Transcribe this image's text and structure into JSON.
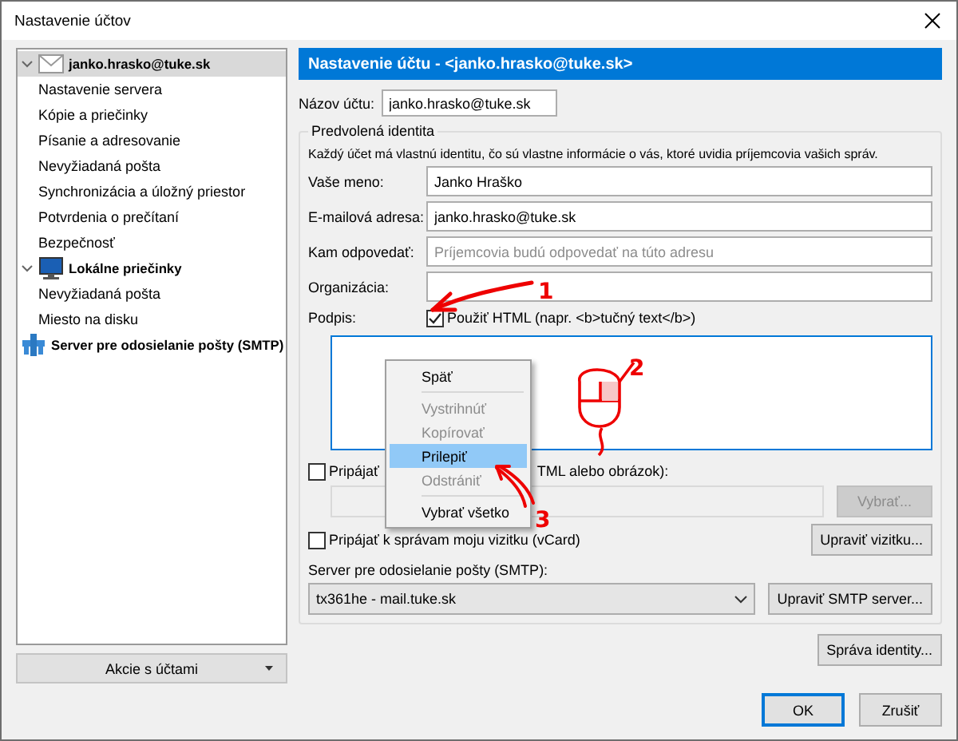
{
  "window": {
    "title": "Nastavenie účtov"
  },
  "sidebar": {
    "items": [
      {
        "label": "janko.hrasko@tuke.sk",
        "expanded": true,
        "selected": true,
        "children": [
          {
            "label": "Nastavenie servera",
            "selected": false
          },
          {
            "label": "Kópie a priečinky",
            "selected": false
          },
          {
            "label": "Písanie a adresovanie",
            "selected": false
          },
          {
            "label": "Nevyžiadaná pošta",
            "selected": false
          },
          {
            "label": "Synchronizácia a úložný priestor",
            "selected": false
          },
          {
            "label": "Potvrdenia o prečítaní",
            "selected": false
          },
          {
            "label": "Bezpečnosť",
            "selected": false
          }
        ]
      },
      {
        "label": "Lokálne priečinky",
        "expanded": true,
        "selected": false,
        "children": [
          {
            "label": "Nevyžiadaná pošta",
            "selected": false
          },
          {
            "label": "Miesto na disku",
            "selected": false
          }
        ]
      },
      {
        "label": "Server pre odosielanie pošty (SMTP)",
        "selected": false
      }
    ]
  },
  "account_actions": {
    "label": "Akcie s účtami"
  },
  "header": "Nastavenie účtu - <janko.hrasko@tuke.sk>",
  "account_name": {
    "label": "Názov účtu:",
    "value": "janko.hrasko@tuke.sk"
  },
  "identity": {
    "title": "Predvolená identita",
    "description": "Každý účet má vlastnú identitu, čo sú vlastne informácie o vás, ktoré uvidia príjemcovia vašich správ.",
    "fields": [
      {
        "label": "Vaše meno:",
        "value": "Janko Hraško"
      },
      {
        "label": "E-mailová adresa:",
        "value": "janko.hrasko@tuke.sk"
      },
      {
        "label": "Kam odpovedať:",
        "placeholder": "Príjemcovia budú odpovedať na túto adresu"
      },
      {
        "label": "Organizácia:"
      }
    ],
    "signature": {
      "label": "Podpis:",
      "html_checkbox": {
        "label": "Použiť HTML (napr. <b>tučný text</b>)",
        "checked": true
      }
    },
    "attach_file": {
      "label_start": "Pripájať",
      "label_end": "TML alebo obrázok):",
      "checked": false,
      "button": {
        "label": "Vybrať...",
        "disabled": true
      }
    },
    "attach_vcard": {
      "label": "Pripájať k správam moju vizitku (vCard)",
      "checked": false,
      "button": "Upraviť vizitku..."
    },
    "smtp": {
      "label": "Server pre odosielanie pošty (SMTP):",
      "value": "tx361he - mail.tuke.sk",
      "button": "Upraviť SMTP server..."
    }
  },
  "manage_identities": "Správa identity...",
  "buttons": [
    {
      "label": "OK",
      "default": true
    },
    {
      "label": "Zrušiť",
      "default": false
    }
  ],
  "context_menu": {
    "items": [
      {
        "kind": "item",
        "label": "Späť",
        "disabled": false,
        "selected": false
      },
      {
        "kind": "separator"
      },
      {
        "kind": "item",
        "label": "Vystrihnúť",
        "disabled": true,
        "selected": false
      },
      {
        "kind": "item",
        "label": "Kopírovať",
        "disabled": true,
        "selected": false
      },
      {
        "kind": "item",
        "label": "Prilepiť",
        "disabled": false,
        "selected": true
      },
      {
        "kind": "item",
        "label": "Odstrániť",
        "disabled": true,
        "selected": false
      },
      {
        "kind": "separator"
      },
      {
        "kind": "item",
        "label": "Vybrať všetko",
        "disabled": false,
        "selected": false
      }
    ]
  },
  "annotations": [
    {
      "kind": "arrow",
      "label": "1"
    },
    {
      "kind": "mouse",
      "label": "2"
    },
    {
      "kind": "arrow",
      "label": "3"
    }
  ]
}
